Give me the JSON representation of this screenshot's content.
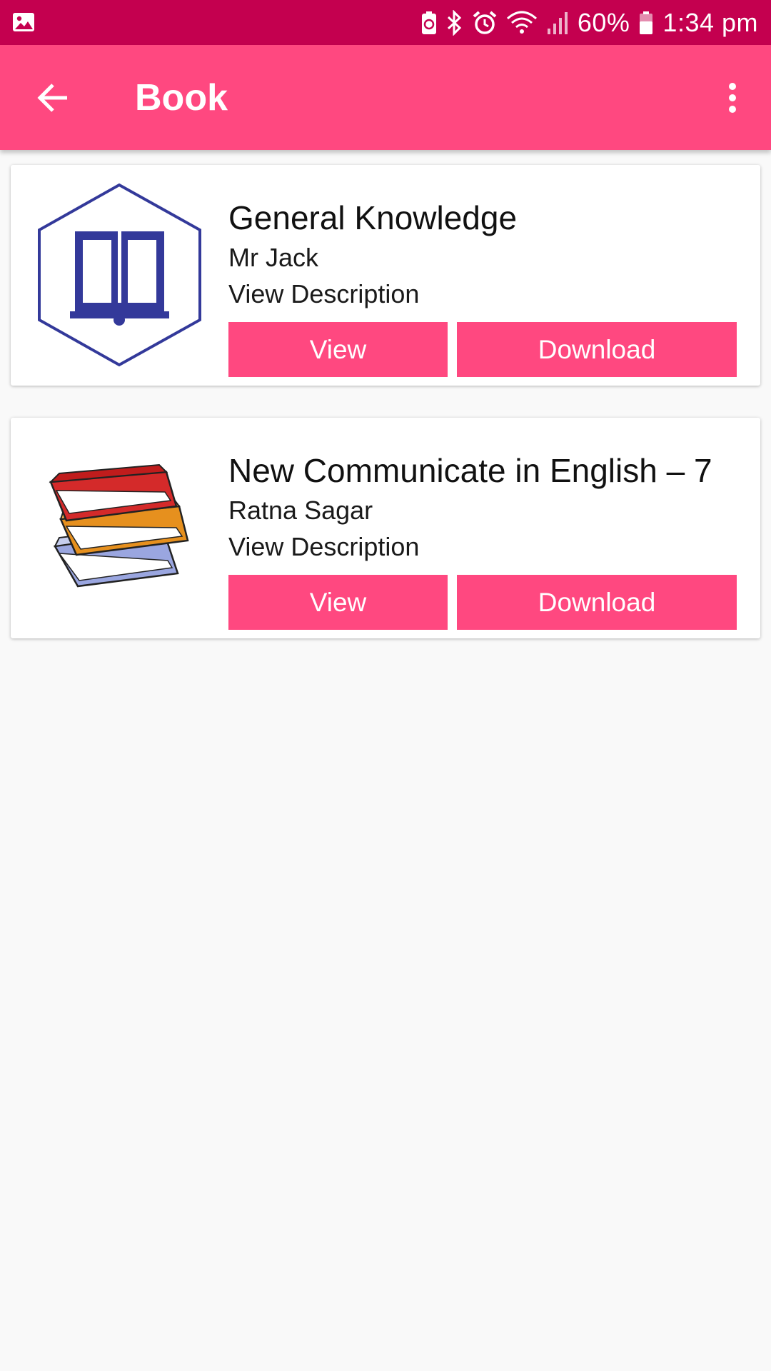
{
  "status_bar": {
    "battery_percent": "60%",
    "time": "1:34 pm",
    "icons": [
      "image-icon",
      "battery-saver-icon",
      "bluetooth-icon",
      "alarm-icon",
      "wifi-icon",
      "signal-icon",
      "battery-icon"
    ]
  },
  "app_bar": {
    "title": "Book",
    "back_icon": "arrow-left-icon",
    "menu_icon": "more-vert-icon"
  },
  "books": [
    {
      "title": "General Knowledge",
      "author": "Mr Jack",
      "description_link": "View Description",
      "view_label": "View",
      "download_label": "Download",
      "thumbnail": "open-book-hexagon-icon"
    },
    {
      "title": "New Communicate in English – 7",
      "author": "Ratna Sagar",
      "description_link": "View Description",
      "view_label": "View",
      "download_label": "Download",
      "thumbnail": "book-stack-icon"
    }
  ],
  "colors": {
    "status_bar": "#c4004f",
    "app_bar": "#ff4880",
    "button": "#ff4880",
    "background": "#f9f9f9"
  }
}
